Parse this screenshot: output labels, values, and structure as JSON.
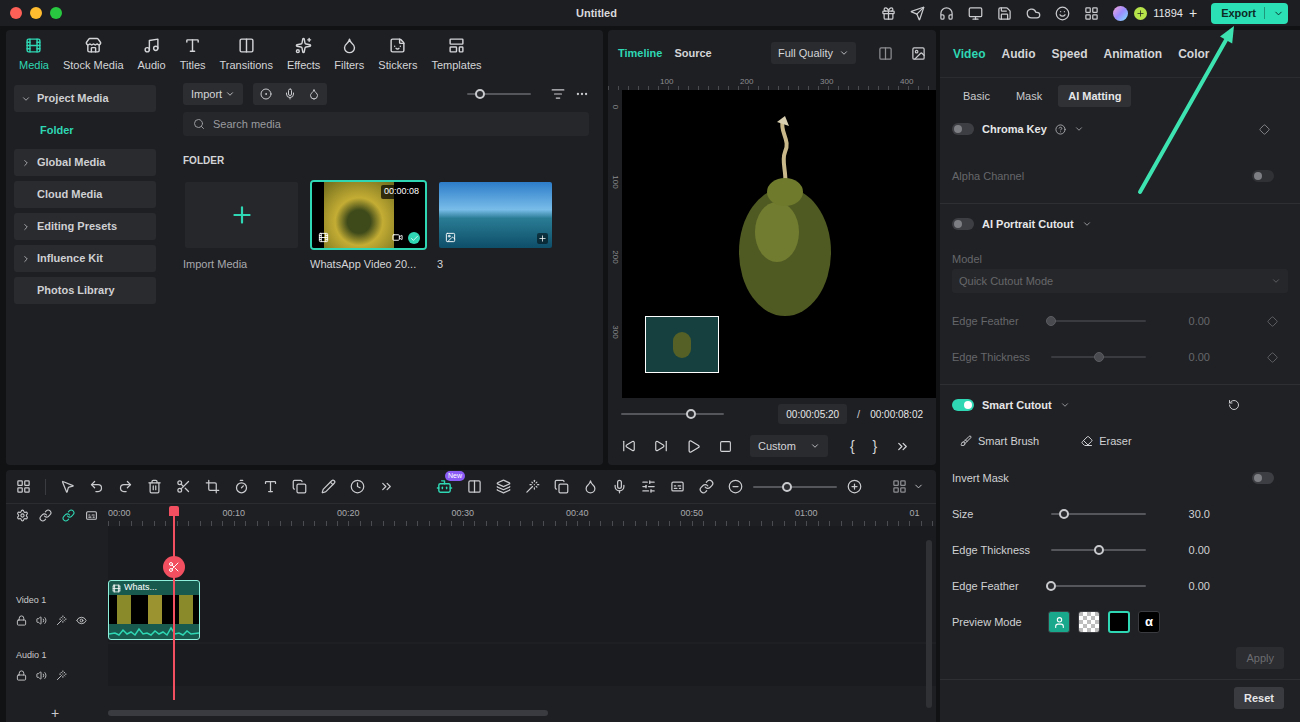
{
  "window": {
    "title": "Untitled"
  },
  "top_bar": {
    "credits": "11894",
    "add": "+",
    "export": "Export"
  },
  "media_tabs": [
    {
      "label": "Media",
      "selected": true
    },
    {
      "label": "Stock Media",
      "selected": false
    },
    {
      "label": "Audio",
      "selected": false
    },
    {
      "label": "Titles",
      "selected": false
    },
    {
      "label": "Transitions",
      "selected": false
    },
    {
      "label": "Effects",
      "selected": false
    },
    {
      "label": "Filters",
      "selected": false
    },
    {
      "label": "Stickers",
      "selected": false
    },
    {
      "label": "Templates",
      "selected": false
    }
  ],
  "media_sidebar": [
    {
      "label": "Project Media",
      "kind": "group",
      "expandable": true,
      "expanded": true,
      "selected": false
    },
    {
      "label": "Folder",
      "kind": "child",
      "expandable": false,
      "expanded": false,
      "selected": true
    },
    {
      "label": "Global Media",
      "kind": "group",
      "expandable": true,
      "expanded": false,
      "selected": false
    },
    {
      "label": "Cloud Media",
      "kind": "group",
      "expandable": false,
      "expanded": false,
      "selected": false
    },
    {
      "label": "Editing Presets",
      "kind": "group",
      "expandable": true,
      "expanded": false,
      "selected": false
    },
    {
      "label": "Influence Kit",
      "kind": "group",
      "expandable": true,
      "expanded": false,
      "selected": false
    },
    {
      "label": "Photos Library",
      "kind": "group",
      "expandable": false,
      "expanded": false,
      "selected": false
    }
  ],
  "media_toolbar": {
    "import": "Import",
    "search_placeholder": "Search media",
    "zoom_level": 0.2
  },
  "folder": {
    "label": "FOLDER",
    "items": [
      {
        "kind": "import",
        "label": "Import Media",
        "selected": false
      },
      {
        "kind": "video",
        "label": "WhatsApp Video 20...",
        "duration": "00:00:08",
        "selected": true,
        "in_use": true
      },
      {
        "kind": "image",
        "label": "3",
        "selected": false
      }
    ]
  },
  "preview": {
    "tabs": [
      {
        "label": "Timeline",
        "selected": true
      },
      {
        "label": "Source",
        "selected": false
      }
    ],
    "quality": "Full Quality",
    "ruler_x": [
      "100",
      "200",
      "300",
      "400"
    ],
    "ruler_y": [
      "0",
      "100",
      "200",
      "300"
    ],
    "progress": 0.68,
    "current_time": "00:00:05:20",
    "separator": "/",
    "total_time": "00:00:08:02",
    "playback": "Custom",
    "mark_in": "{",
    "mark_out": "}"
  },
  "properties": {
    "tabs": [
      {
        "label": "Video",
        "selected": true
      },
      {
        "label": "Audio",
        "selected": false
      },
      {
        "label": "Speed",
        "selected": false
      },
      {
        "label": "Animation",
        "selected": false
      },
      {
        "label": "Color",
        "selected": false
      }
    ],
    "subtabs": [
      {
        "label": "Basic",
        "selected": false
      },
      {
        "label": "Mask",
        "selected": false
      },
      {
        "label": "AI Matting",
        "selected": true
      }
    ],
    "chroma_key": {
      "label": "Chroma Key",
      "on": false,
      "alpha_channel": {
        "label": "Alpha Channel",
        "on": false,
        "disabled": true
      }
    },
    "ai_portrait": {
      "label": "AI Portrait Cutout",
      "on": false,
      "disabled": true,
      "model_label": "Model",
      "model": "Quick Cutout Mode",
      "sliders": [
        {
          "label": "Edge Feather",
          "level": 0,
          "value": "0.00",
          "keyframe": true
        },
        {
          "label": "Edge Thickness",
          "level": 0.5,
          "value": "0.00",
          "keyframe": true
        }
      ]
    },
    "smart_cutout": {
      "label": "Smart Cutout",
      "on": true,
      "tools": [
        {
          "label": "Smart Brush",
          "kind": "brush"
        },
        {
          "label": "Eraser",
          "kind": "eraser"
        }
      ],
      "invert_mask": {
        "label": "Invert Mask",
        "on": false
      },
      "sliders": [
        {
          "label": "Size",
          "level": 0.14,
          "value": "30.0",
          "keyframe": false
        },
        {
          "label": "Edge Thickness",
          "level": 0.5,
          "value": "0.00",
          "keyframe": false
        },
        {
          "label": "Edge Feather",
          "level": 0,
          "value": "0.00",
          "keyframe": false
        }
      ],
      "preview_mode": {
        "label": "Preview Mode",
        "options": [
          {
            "kind": "person",
            "selected": false
          },
          {
            "kind": "checker",
            "selected": false
          },
          {
            "kind": "black",
            "selected": true
          },
          {
            "kind": "alpha",
            "label": "α",
            "selected": false
          }
        ]
      },
      "apply": {
        "label": "Apply",
        "disabled": true
      }
    },
    "reset": {
      "label": "Reset"
    }
  },
  "timeline": {
    "zoom_level": 0.4,
    "new_badge": "New",
    "ruler": [
      "00:00",
      "00:10",
      "00:20",
      "00:30",
      "00:40",
      "00:50",
      "01:00",
      "01"
    ],
    "tracks": [
      {
        "kind": "video",
        "label": "Video 1",
        "clip": {
          "label": "Whats..."
        }
      },
      {
        "kind": "audio",
        "label": "Audio 1"
      }
    ],
    "add_track": "+"
  }
}
